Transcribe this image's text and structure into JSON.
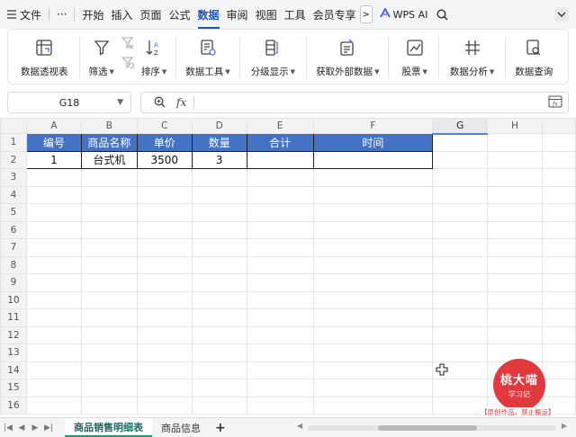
{
  "menu": {
    "file": "文件",
    "more": "···",
    "tabs": [
      "开始",
      "插入",
      "页面",
      "公式",
      "数据",
      "审阅",
      "视图",
      "工具",
      "会员专享"
    ],
    "active_tab": "数据",
    "overflow": ">",
    "ai": "WPS AI"
  },
  "ribbon": {
    "pivot": "数据透视表",
    "filter": "筛选",
    "sort": "排序",
    "datatools": "数据工具",
    "group": "分级显示",
    "external": "获取外部数据",
    "stocks": "股票",
    "analysis": "数据分析",
    "query": "数据查询"
  },
  "formula_bar": {
    "cell_ref": "G18",
    "fx": "fx",
    "value": ""
  },
  "grid": {
    "columns": [
      "A",
      "B",
      "C",
      "D",
      "E",
      "F",
      "G",
      "H"
    ],
    "selected_column": "G",
    "rows": [
      "1",
      "2",
      "3",
      "4",
      "5",
      "6",
      "7",
      "8",
      "9",
      "10",
      "11",
      "12",
      "13",
      "14",
      "15",
      "16"
    ],
    "headers": [
      "编号",
      "商品名称",
      "单价",
      "数量",
      "合计",
      "时间"
    ],
    "row2": [
      "1",
      "台式机",
      "3500",
      "3",
      "",
      ""
    ]
  },
  "watermark": {
    "title": "桃大喵",
    "subtitle": "学习记",
    "caption": "【原创作品，禁止搬运】"
  },
  "sheet_tabs": {
    "tabs": [
      "商品销售明细表",
      "商品信息"
    ],
    "active": "商品销售明细表",
    "add": "+"
  },
  "colors": {
    "header_fill": "#4472C4",
    "accent": "#1A56C4",
    "stamp": "#E03A3E"
  }
}
